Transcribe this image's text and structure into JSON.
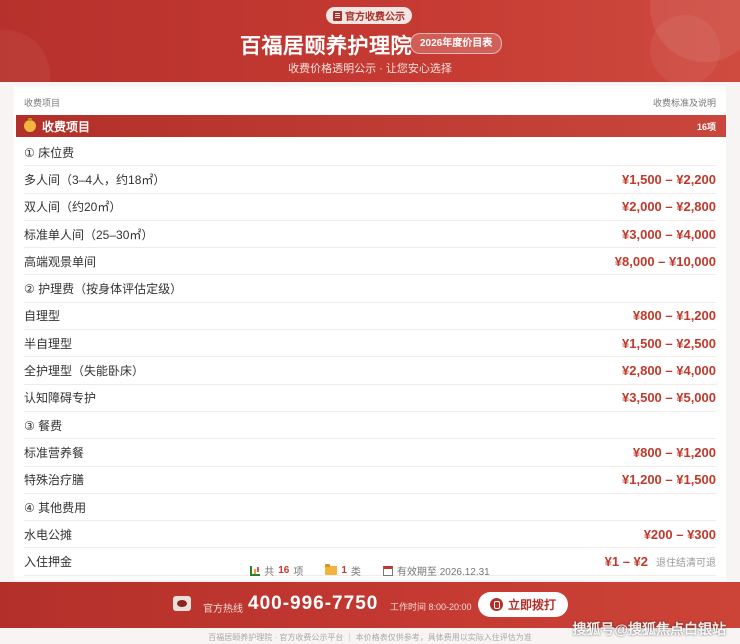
{
  "header": {
    "badge": "官方收费公示",
    "title": "百福居颐养护理院",
    "year_pill": "2026年度价目表",
    "subtitle": "收费价格透明公示 · 让您安心选择"
  },
  "table": {
    "col_left": "收费项目",
    "col_right": "收费标准及说明",
    "section_label": "收费项目",
    "section_count": "16项",
    "rows": [
      {
        "name": "① 床位费",
        "price": "",
        "note": ""
      },
      {
        "name": "多人间（3–4人，约18㎡）",
        "price": "¥1,500 – ¥2,200",
        "note": ""
      },
      {
        "name": "双人间（约20㎡）",
        "price": "¥2,000 – ¥2,800",
        "note": ""
      },
      {
        "name": "标准单人间（25–30㎡）",
        "price": "¥3,000 – ¥4,000",
        "note": ""
      },
      {
        "name": "高端观景单间",
        "price": "¥8,000 – ¥10,000",
        "note": ""
      },
      {
        "name": "② 护理费（按身体评估定级）",
        "price": "",
        "note": ""
      },
      {
        "name": "自理型",
        "price": "¥800 – ¥1,200",
        "note": ""
      },
      {
        "name": "半自理型",
        "price": "¥1,500 – ¥2,500",
        "note": ""
      },
      {
        "name": "全护理型（失能卧床）",
        "price": "¥2,800 – ¥4,000",
        "note": ""
      },
      {
        "name": "认知障碍专护",
        "price": "¥3,500 – ¥5,000",
        "note": ""
      },
      {
        "name": "③ 餐费",
        "price": "",
        "note": ""
      },
      {
        "name": "标准营养餐",
        "price": "¥800 – ¥1,200",
        "note": ""
      },
      {
        "name": "特殊治疗膳",
        "price": "¥1,200 – ¥1,500",
        "note": ""
      },
      {
        "name": "④ 其他费用",
        "price": "",
        "note": ""
      },
      {
        "name": "水电公摊",
        "price": "¥200 – ¥300",
        "note": ""
      },
      {
        "name": "入住押金",
        "price": "¥1 – ¥2",
        "note": "退住结清可退"
      }
    ]
  },
  "stats": {
    "total_pre": "共",
    "total_num": "16",
    "total_post": "项",
    "cat_num": "1",
    "cat_post": "类",
    "valid": "有效期至 2026.12.31"
  },
  "footer": {
    "hotline_label": "官方热线",
    "hotline_number": "400-996-7750",
    "hours": "工作时间 8:00-20:00",
    "call_button": "立即拨打"
  },
  "disclaimer": "百福居颐养护理院 · 官方收费公示平台 ｜ 本价格表仅供参考，具体费用以实际入住评估为准",
  "watermark": "搜狐号@搜狐焦点白银站",
  "colors": {
    "brand_red": "#c0392b",
    "gold": "#f0b63e"
  },
  "icons": [
    "document-icon",
    "money-bag-icon",
    "chart-icon",
    "folder-icon",
    "calendar-icon",
    "phone-icon",
    "call-icon"
  ]
}
